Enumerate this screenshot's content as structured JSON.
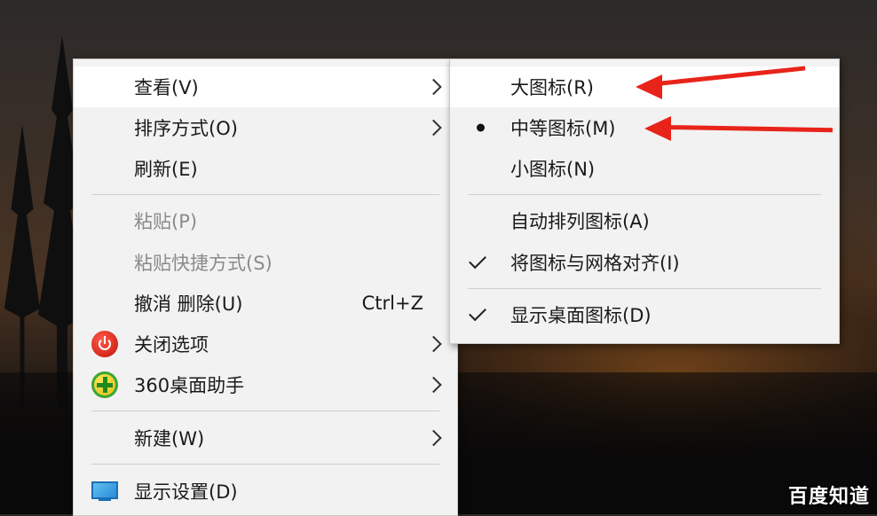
{
  "context_menu": {
    "items": [
      {
        "label": "查看(V)"
      },
      {
        "label": "排序方式(O)"
      },
      {
        "label": "刷新(E)"
      },
      {
        "label": "粘贴(P)"
      },
      {
        "label": "粘贴快捷方式(S)"
      },
      {
        "label": "撤消 删除(U)",
        "shortcut": "Ctrl+Z"
      },
      {
        "label": "关闭选项"
      },
      {
        "label": "360桌面助手"
      },
      {
        "label": "新建(W)"
      },
      {
        "label": "显示设置(D)"
      }
    ]
  },
  "view_submenu": {
    "items": [
      {
        "label": "大图标(R)"
      },
      {
        "label": "中等图标(M)",
        "state": "selected"
      },
      {
        "label": "小图标(N)"
      },
      {
        "label": "自动排列图标(A)"
      },
      {
        "label": "将图标与网格对齐(I)",
        "state": "checked"
      },
      {
        "label": "显示桌面图标(D)",
        "state": "checked"
      }
    ]
  },
  "annotation_color": "#e8241a",
  "watermark": "百度知道"
}
